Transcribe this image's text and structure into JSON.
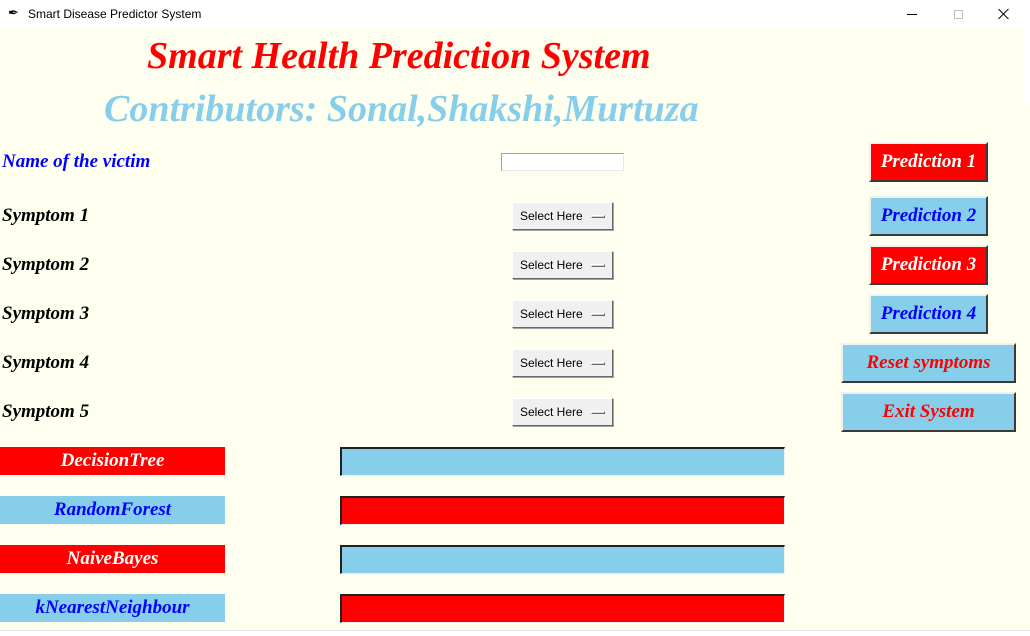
{
  "window": {
    "title": "Smart Disease Predictor System",
    "icon": "feather-icon"
  },
  "colors": {
    "background": "#fffff0",
    "red": "#ff0000",
    "sky_blue": "#87ceeb",
    "blue_text": "#0000ff",
    "white_text": "#ffffff",
    "black_text": "#000000"
  },
  "heading": {
    "title": "Smart Health Prediction System",
    "contributors": "Contributors: Sonal,Shakshi,Murtuza"
  },
  "form": {
    "name_label": "Name of the victim",
    "name_value": "",
    "symptoms": [
      {
        "label": "Symptom 1",
        "selected": "Select Here"
      },
      {
        "label": "Symptom 2",
        "selected": "Select Here"
      },
      {
        "label": "Symptom 3",
        "selected": "Select Here"
      },
      {
        "label": "Symptom 4",
        "selected": "Select Here"
      },
      {
        "label": "Symptom 5",
        "selected": "Select Here"
      }
    ]
  },
  "buttons": {
    "prediction_1": "Prediction 1",
    "prediction_2": "Prediction 2",
    "prediction_3": "Prediction 3",
    "prediction_4": "Prediction 4",
    "reset": "Reset symptoms",
    "exit": "Exit System"
  },
  "algorithms": [
    {
      "name": "DecisionTree",
      "result": ""
    },
    {
      "name": "RandomForest",
      "result": ""
    },
    {
      "name": "NaiveBayes",
      "result": ""
    },
    {
      "name": "kNearestNeighbour",
      "result": ""
    }
  ]
}
